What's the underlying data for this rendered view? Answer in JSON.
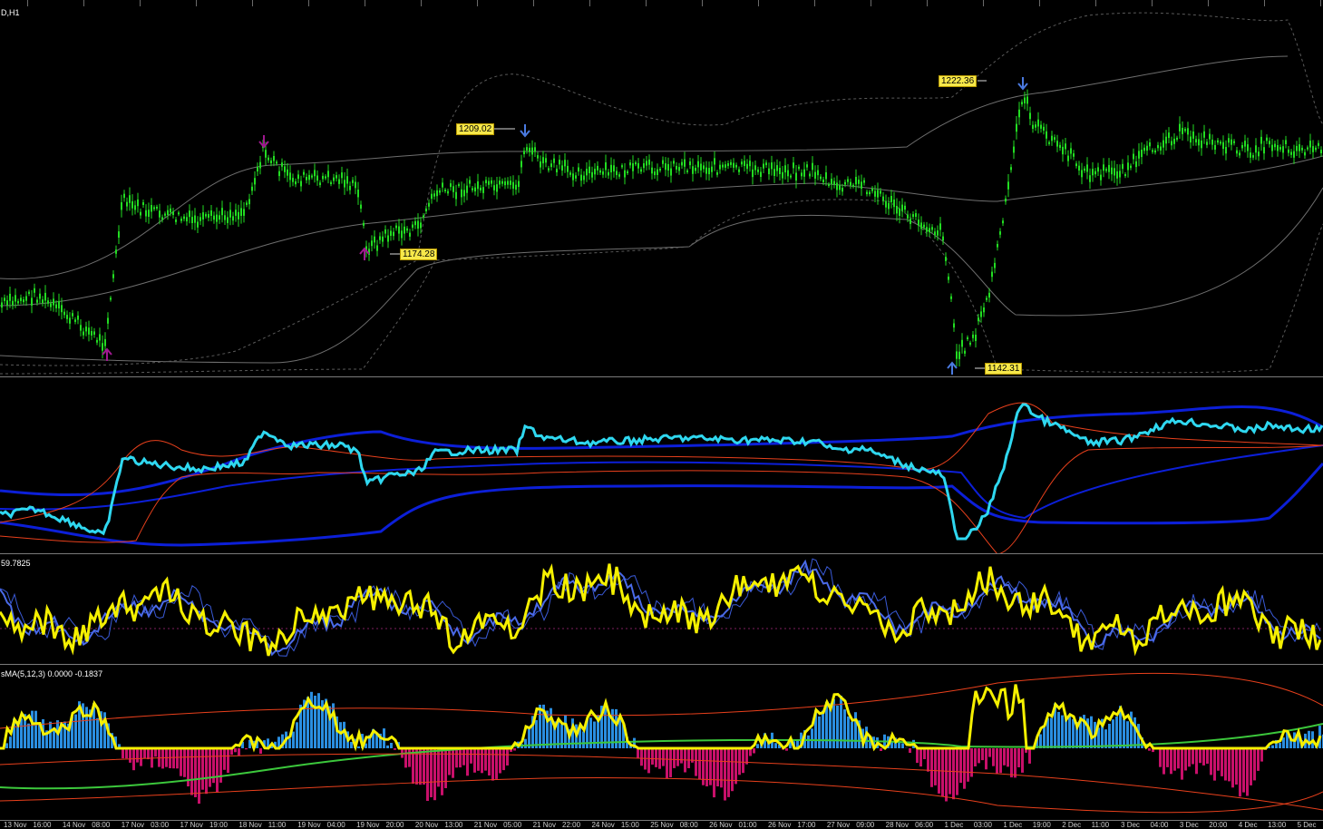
{
  "window": {
    "title_fragment": "D,H1"
  },
  "price_labels": {
    "high1": "1209.02",
    "low1": "1174.28",
    "high2": "1222.36",
    "low2": "1142.31"
  },
  "panes": {
    "indicator2_label": "59.7825",
    "indicator3_label": "sMA(5,12,3) 0.0000 -0.1837"
  },
  "time_axis": [
    "13 Nov",
    "16:00",
    "14 Nov",
    "08:00",
    "17 Nov",
    "03:00",
    "17 Nov",
    "19:00",
    "18 Nov",
    "11:00",
    "19 Nov",
    "04:00",
    "19 Nov",
    "20:00",
    "20 Nov",
    "13:00",
    "21 Nov",
    "05:00",
    "21 Nov",
    "22:00",
    "24 Nov",
    "15:00",
    "25 Nov",
    "08:00",
    "26 Nov",
    "01:00",
    "26 Nov",
    "17:00",
    "27 Nov",
    "09:00",
    "28 Nov",
    "06:00",
    "1 Dec",
    "03:00",
    "1 Dec",
    "19:00",
    "2 Dec",
    "11:00",
    "3 Dec",
    "04:00",
    "3 Dec",
    "20:00",
    "4 Dec",
    "13:00",
    "5 Dec"
  ],
  "colors": {
    "candle": "#22dd22",
    "band": "#6e6e6e",
    "cyan": "#2fd8f0",
    "blue_band": "#0c1fd8",
    "red_band": "#e8401c",
    "yellow": "#f5f000",
    "hist_pos": "#2a8ee0",
    "hist_neg": "#c8106a",
    "signal_green": "#3cc83c",
    "arrow_purple": "#a01890",
    "arrow_blue": "#4a7ae0"
  },
  "icons": [
    "arrow-down-icon",
    "arrow-up-icon"
  ]
}
